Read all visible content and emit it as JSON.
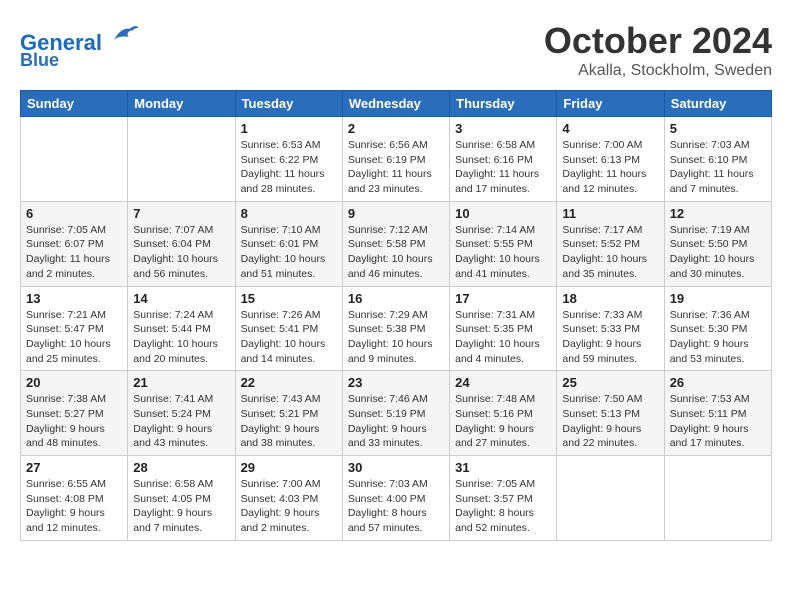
{
  "header": {
    "logo_line1": "General",
    "logo_line2": "Blue",
    "month": "October 2024",
    "location": "Akalla, Stockholm, Sweden"
  },
  "weekdays": [
    "Sunday",
    "Monday",
    "Tuesday",
    "Wednesday",
    "Thursday",
    "Friday",
    "Saturday"
  ],
  "weeks": [
    [
      {
        "day": "",
        "detail": ""
      },
      {
        "day": "",
        "detail": ""
      },
      {
        "day": "1",
        "detail": "Sunrise: 6:53 AM\nSunset: 6:22 PM\nDaylight: 11 hours and 28 minutes."
      },
      {
        "day": "2",
        "detail": "Sunrise: 6:56 AM\nSunset: 6:19 PM\nDaylight: 11 hours and 23 minutes."
      },
      {
        "day": "3",
        "detail": "Sunrise: 6:58 AM\nSunset: 6:16 PM\nDaylight: 11 hours and 17 minutes."
      },
      {
        "day": "4",
        "detail": "Sunrise: 7:00 AM\nSunset: 6:13 PM\nDaylight: 11 hours and 12 minutes."
      },
      {
        "day": "5",
        "detail": "Sunrise: 7:03 AM\nSunset: 6:10 PM\nDaylight: 11 hours and 7 minutes."
      }
    ],
    [
      {
        "day": "6",
        "detail": "Sunrise: 7:05 AM\nSunset: 6:07 PM\nDaylight: 11 hours and 2 minutes."
      },
      {
        "day": "7",
        "detail": "Sunrise: 7:07 AM\nSunset: 6:04 PM\nDaylight: 10 hours and 56 minutes."
      },
      {
        "day": "8",
        "detail": "Sunrise: 7:10 AM\nSunset: 6:01 PM\nDaylight: 10 hours and 51 minutes."
      },
      {
        "day": "9",
        "detail": "Sunrise: 7:12 AM\nSunset: 5:58 PM\nDaylight: 10 hours and 46 minutes."
      },
      {
        "day": "10",
        "detail": "Sunrise: 7:14 AM\nSunset: 5:55 PM\nDaylight: 10 hours and 41 minutes."
      },
      {
        "day": "11",
        "detail": "Sunrise: 7:17 AM\nSunset: 5:52 PM\nDaylight: 10 hours and 35 minutes."
      },
      {
        "day": "12",
        "detail": "Sunrise: 7:19 AM\nSunset: 5:50 PM\nDaylight: 10 hours and 30 minutes."
      }
    ],
    [
      {
        "day": "13",
        "detail": "Sunrise: 7:21 AM\nSunset: 5:47 PM\nDaylight: 10 hours and 25 minutes."
      },
      {
        "day": "14",
        "detail": "Sunrise: 7:24 AM\nSunset: 5:44 PM\nDaylight: 10 hours and 20 minutes."
      },
      {
        "day": "15",
        "detail": "Sunrise: 7:26 AM\nSunset: 5:41 PM\nDaylight: 10 hours and 14 minutes."
      },
      {
        "day": "16",
        "detail": "Sunrise: 7:29 AM\nSunset: 5:38 PM\nDaylight: 10 hours and 9 minutes."
      },
      {
        "day": "17",
        "detail": "Sunrise: 7:31 AM\nSunset: 5:35 PM\nDaylight: 10 hours and 4 minutes."
      },
      {
        "day": "18",
        "detail": "Sunrise: 7:33 AM\nSunset: 5:33 PM\nDaylight: 9 hours and 59 minutes."
      },
      {
        "day": "19",
        "detail": "Sunrise: 7:36 AM\nSunset: 5:30 PM\nDaylight: 9 hours and 53 minutes."
      }
    ],
    [
      {
        "day": "20",
        "detail": "Sunrise: 7:38 AM\nSunset: 5:27 PM\nDaylight: 9 hours and 48 minutes."
      },
      {
        "day": "21",
        "detail": "Sunrise: 7:41 AM\nSunset: 5:24 PM\nDaylight: 9 hours and 43 minutes."
      },
      {
        "day": "22",
        "detail": "Sunrise: 7:43 AM\nSunset: 5:21 PM\nDaylight: 9 hours and 38 minutes."
      },
      {
        "day": "23",
        "detail": "Sunrise: 7:46 AM\nSunset: 5:19 PM\nDaylight: 9 hours and 33 minutes."
      },
      {
        "day": "24",
        "detail": "Sunrise: 7:48 AM\nSunset: 5:16 PM\nDaylight: 9 hours and 27 minutes."
      },
      {
        "day": "25",
        "detail": "Sunrise: 7:50 AM\nSunset: 5:13 PM\nDaylight: 9 hours and 22 minutes."
      },
      {
        "day": "26",
        "detail": "Sunrise: 7:53 AM\nSunset: 5:11 PM\nDaylight: 9 hours and 17 minutes."
      }
    ],
    [
      {
        "day": "27",
        "detail": "Sunrise: 6:55 AM\nSunset: 4:08 PM\nDaylight: 9 hours and 12 minutes."
      },
      {
        "day": "28",
        "detail": "Sunrise: 6:58 AM\nSunset: 4:05 PM\nDaylight: 9 hours and 7 minutes."
      },
      {
        "day": "29",
        "detail": "Sunrise: 7:00 AM\nSunset: 4:03 PM\nDaylight: 9 hours and 2 minutes."
      },
      {
        "day": "30",
        "detail": "Sunrise: 7:03 AM\nSunset: 4:00 PM\nDaylight: 8 hours and 57 minutes."
      },
      {
        "day": "31",
        "detail": "Sunrise: 7:05 AM\nSunset: 3:57 PM\nDaylight: 8 hours and 52 minutes."
      },
      {
        "day": "",
        "detail": ""
      },
      {
        "day": "",
        "detail": ""
      }
    ]
  ]
}
